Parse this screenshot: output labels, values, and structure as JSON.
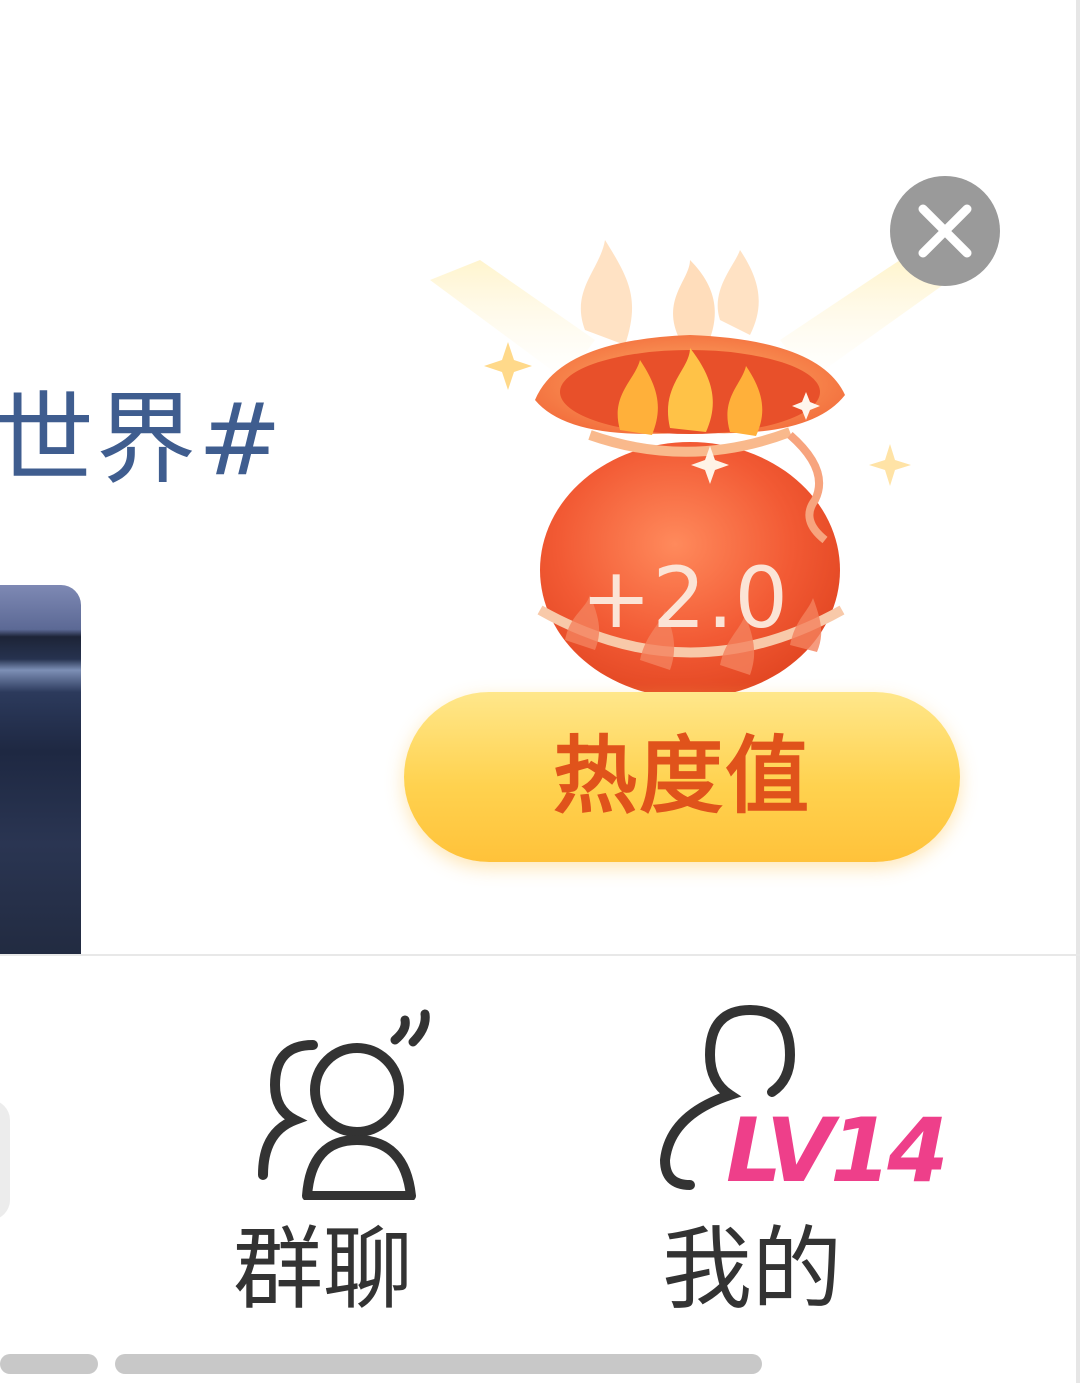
{
  "topic": {
    "text": "世界#"
  },
  "popup": {
    "gain": "+2.0",
    "label": "热度值",
    "close_icon": "close-icon",
    "bag_icon": "fire-lucky-bag-icon"
  },
  "tabbar": {
    "items": [
      {
        "id": "group-chat",
        "label": "群聊",
        "icon": "group-chat-icon"
      },
      {
        "id": "mine",
        "label": "我的",
        "icon": "user-profile-icon",
        "badge": "LV14"
      }
    ]
  },
  "colors": {
    "topic_text": "#3f5d8f",
    "bag_red": "#f0613a",
    "pill_yellow": "#ffd24f",
    "pill_text": "#e0531b",
    "level_pink": "#ee3f8a",
    "close_gray": "#9a9a9a"
  }
}
